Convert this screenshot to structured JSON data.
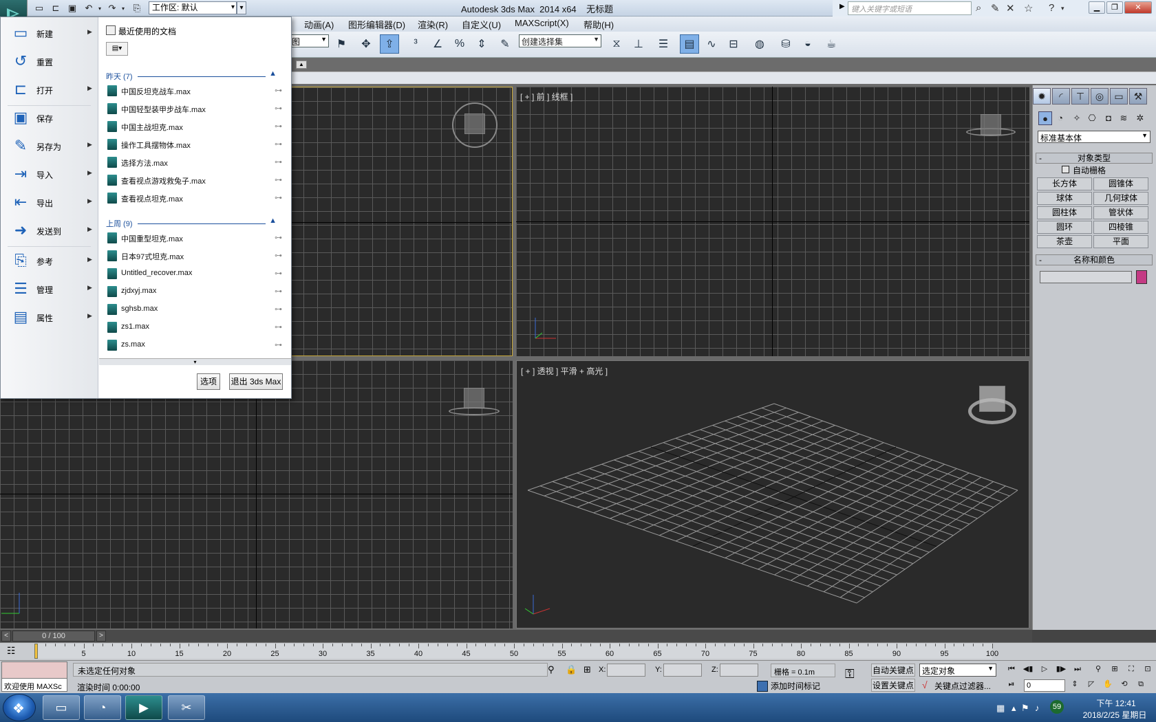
{
  "window": {
    "title": "Autodesk 3ds Max  2014 x64    无标题",
    "workspace": "工作区: 默认",
    "search_placeholder": "键入关键字或短语"
  },
  "menus": [
    "动画(A)",
    "图形编辑器(D)",
    "渲染(R)",
    "自定义(U)",
    "MAXScript(X)",
    "帮助(H)"
  ],
  "toolbar": {
    "view_selector": "图",
    "selection_set": "创建选择集"
  },
  "file_menu": {
    "commands": [
      {
        "label": "新建",
        "has_arrow": true,
        "icon": "new-document-icon"
      },
      {
        "label": "重置",
        "has_arrow": false,
        "icon": "reset-icon"
      },
      {
        "label": "打开",
        "has_arrow": true,
        "icon": "open-folder-icon"
      },
      {
        "label": "保存",
        "has_arrow": false,
        "icon": "save-disk-icon"
      },
      {
        "label": "另存为",
        "has_arrow": true,
        "icon": "save-as-icon"
      },
      {
        "label": "导入",
        "has_arrow": true,
        "icon": "import-icon"
      },
      {
        "label": "导出",
        "has_arrow": true,
        "icon": "export-icon"
      },
      {
        "label": "发送到",
        "has_arrow": true,
        "icon": "send-to-icon"
      },
      {
        "label": "参考",
        "has_arrow": true,
        "icon": "reference-icon"
      },
      {
        "label": "管理",
        "has_arrow": true,
        "icon": "manage-icon"
      },
      {
        "label": "属性",
        "has_arrow": true,
        "icon": "properties-icon"
      }
    ],
    "recent_title": "最近使用的文档",
    "groups": [
      {
        "label": "昨天 (7)",
        "files": [
          "中国反坦克战车.max",
          "中国轻型装甲步战车.max",
          "中国主战坦克.max",
          "操作工具摆物体.max",
          "选择方法.max",
          "查看视点游戏救兔子.max",
          "查看视点坦克.max"
        ]
      },
      {
        "label": "上周 (9)",
        "files": [
          "中国重型坦克.max",
          "日本97式坦克.max",
          "Untitled_recover.max",
          "zjdxyj.max",
          "sghsb.max",
          "zs1.max",
          "zs.max"
        ]
      }
    ],
    "options_label": "选项",
    "exit_label": "退出 3ds Max"
  },
  "viewports": {
    "front": "[ + ] 前 ] 线框 ]",
    "perspective": "[ + ] 透视 ] 平滑 + 高光 ]"
  },
  "command_panel": {
    "dropdown": "标准基本体",
    "object_type_title": "对象类型",
    "auto_grid": "自动栅格",
    "objects": [
      "长方体",
      "圆锥体",
      "球体",
      "几何球体",
      "圆柱体",
      "管状体",
      "圆环",
      "四棱锥",
      "茶壶",
      "平面"
    ],
    "name_color_title": "名称和颜色",
    "object_color": "#c43b84"
  },
  "timeline": {
    "slider": "0 / 100",
    "ticks": [
      "5",
      "10",
      "15",
      "20",
      "25",
      "30",
      "35",
      "40",
      "45",
      "50",
      "55",
      "60",
      "65",
      "70",
      "75",
      "80",
      "85",
      "90",
      "95",
      "100"
    ]
  },
  "status": {
    "maxscript": "欢迎使用 MAXSc",
    "message": "未选定任何对象",
    "render_time": "渲染时间  0:00:00",
    "x_label": "X:",
    "y_label": "Y:",
    "z_label": "Z:",
    "grid": "栅格 = 0.1m",
    "add_time_tag": "添加时间标记",
    "auto_key": "自动关键点",
    "set_key": "设置关键点",
    "selected_object": "选定对象",
    "key_filters": "关键点过滤器...",
    "frame": "0"
  },
  "taskbar": {
    "time": "下午 12:41",
    "date": "2018/2/25 星期日",
    "badge": "59"
  }
}
